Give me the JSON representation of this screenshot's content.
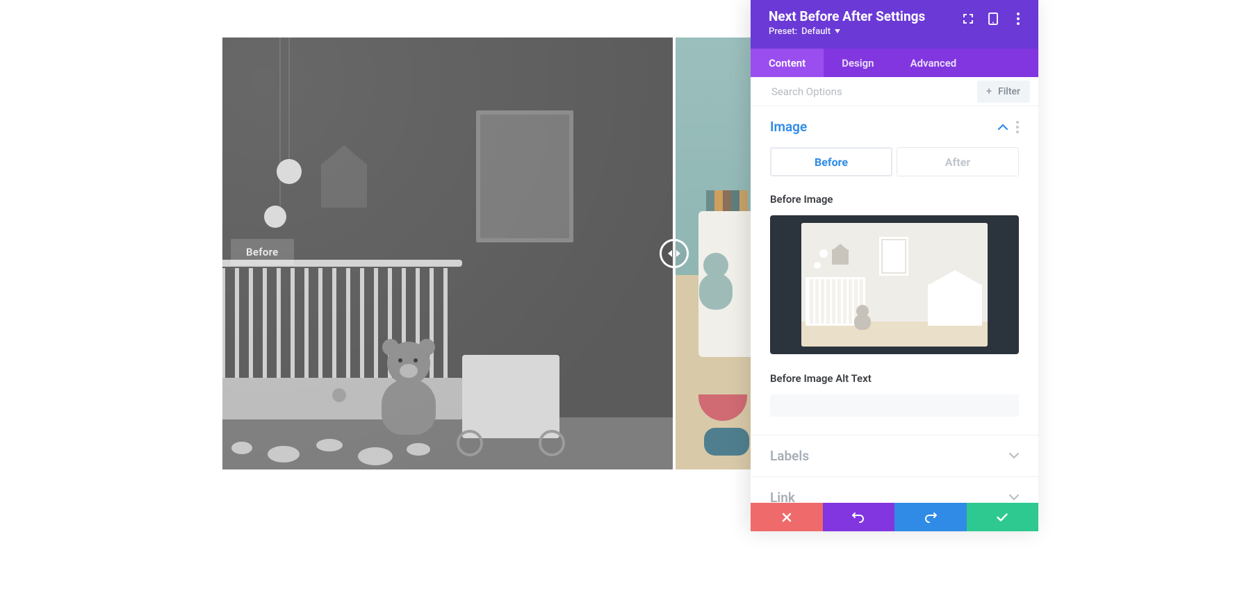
{
  "panel": {
    "title": "Next Before After Settings",
    "preset_label": "Preset:",
    "preset_value": "Default"
  },
  "tabs": {
    "content": "Content",
    "design": "Design",
    "advanced": "Advanced"
  },
  "search": {
    "placeholder": "Search Options",
    "filter_label": "Filter"
  },
  "sections": {
    "image": "Image",
    "labels": "Labels",
    "link": "Link"
  },
  "image_tabs": {
    "before": "Before",
    "after": "After"
  },
  "fields": {
    "before_image_label": "Before Image",
    "before_alt_label": "Before Image Alt Text",
    "before_alt_value": ""
  },
  "preview": {
    "badge_before": "Before",
    "split_pct": 0.855
  }
}
